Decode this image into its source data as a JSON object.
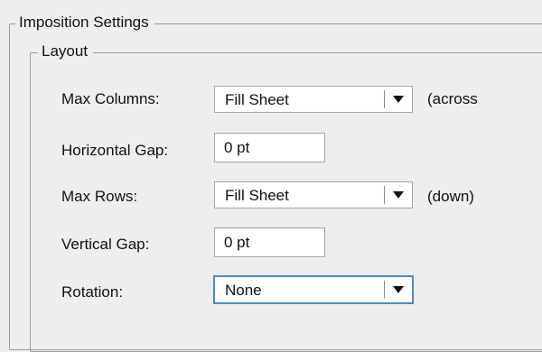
{
  "imposition_settings": {
    "title": "Imposition Settings",
    "layout": {
      "title": "Layout",
      "max_columns": {
        "label": "Max Columns:",
        "value": "Fill Sheet",
        "hint": "(across"
      },
      "horizontal_gap": {
        "label": "Horizontal Gap:",
        "value": "0 pt"
      },
      "max_rows": {
        "label": "Max Rows:",
        "value": "Fill Sheet",
        "hint": "(down)"
      },
      "vertical_gap": {
        "label": "Vertical Gap:",
        "value": "0 pt"
      },
      "rotation": {
        "label": "Rotation:",
        "value": "None"
      }
    }
  },
  "icons": {
    "dropdown": "chevron-down-icon"
  },
  "colors": {
    "background": "#eeeeee",
    "group_border": "#9c9c9c",
    "focus_ring": "#4b8ac9",
    "text": "#111111"
  }
}
